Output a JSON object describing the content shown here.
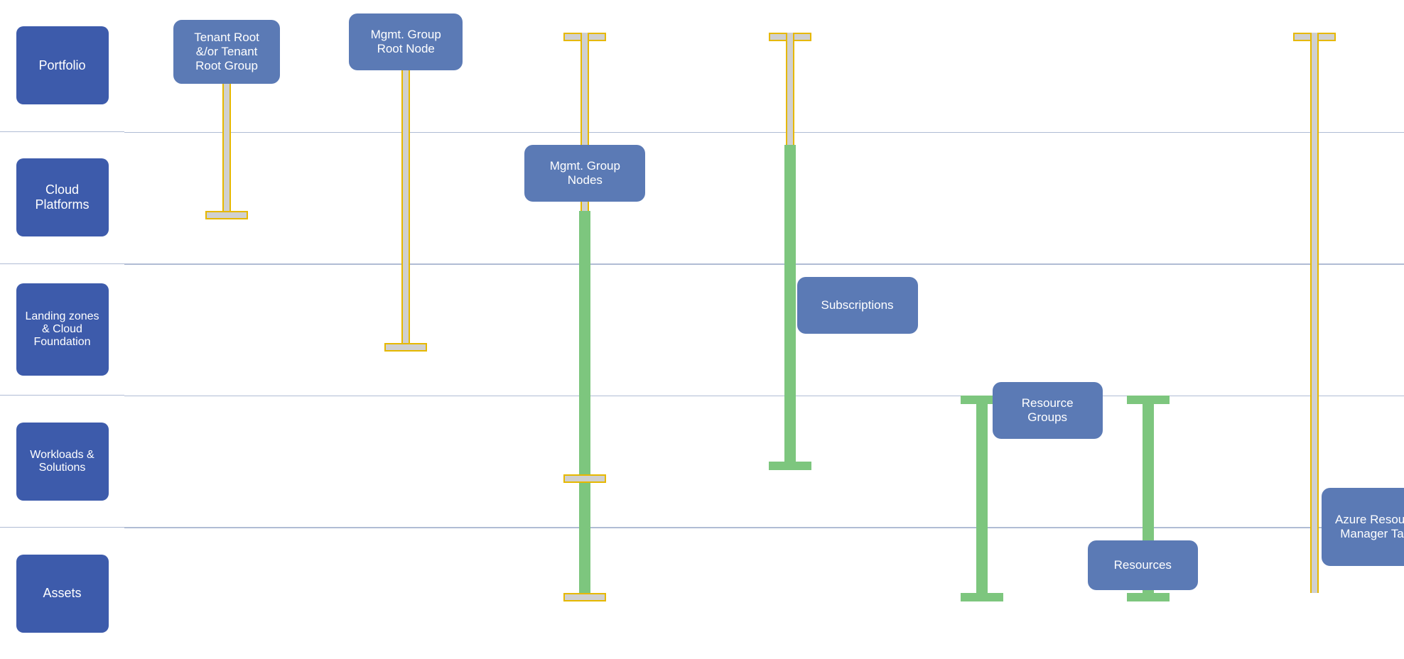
{
  "colors": {
    "blue": "#3d5bab",
    "sidebarBlue": "#3d5bab",
    "nodeBlue": "#5b7ab5",
    "lineBlue": "#b0bcd4",
    "gray": "#d0d0d0",
    "grayBorder": "#e6b800",
    "green": "#7dc67e"
  },
  "rows": [
    {
      "id": "portfolio",
      "label": "Portfolio"
    },
    {
      "id": "cloud-platforms",
      "label": "Cloud Platforms"
    },
    {
      "id": "landing-zones",
      "label": "Landing zones & Cloud Foundation"
    },
    {
      "id": "workloads",
      "label": "Workloads & Solutions"
    },
    {
      "id": "assets",
      "label": "Assets"
    }
  ],
  "nodes": [
    {
      "id": "tenant-root",
      "label": "Tenant Root &/or Tenant Root Group"
    },
    {
      "id": "mgmt-group-root",
      "label": "Mgmt. Group Root Node"
    },
    {
      "id": "mgmt-group-nodes",
      "label": "Mgmt. Group Nodes"
    },
    {
      "id": "subscriptions",
      "label": "Subscriptions"
    },
    {
      "id": "resource-groups",
      "label": "Resource Groups"
    },
    {
      "id": "resources",
      "label": "Resources"
    },
    {
      "id": "arm-tags",
      "label": "Azure Resource Manager Tags"
    }
  ]
}
